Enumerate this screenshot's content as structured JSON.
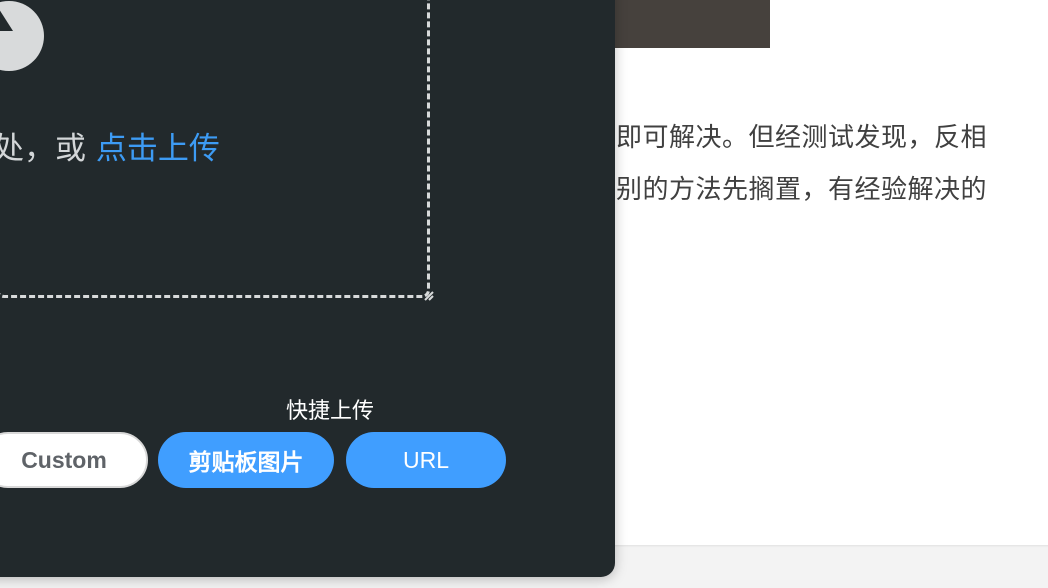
{
  "article": {
    "line1": "即可解决。但经测试发现，反相",
    "line2": "别的方法先搁置，有经验解决的"
  },
  "upload": {
    "drop_text": "处，或 ",
    "drop_link": "点击上传",
    "quick_upload_title": "快捷上传",
    "buttons": {
      "custom": "Custom",
      "clipboard": "剪贴板图片",
      "url": "URL"
    }
  },
  "colors": {
    "modal_bg": "#22292c",
    "accent": "#409eff",
    "link": "#3d9bf4"
  },
  "icons": {
    "upload": "cloud-upload-icon",
    "resize": "resize-corner-icon"
  }
}
